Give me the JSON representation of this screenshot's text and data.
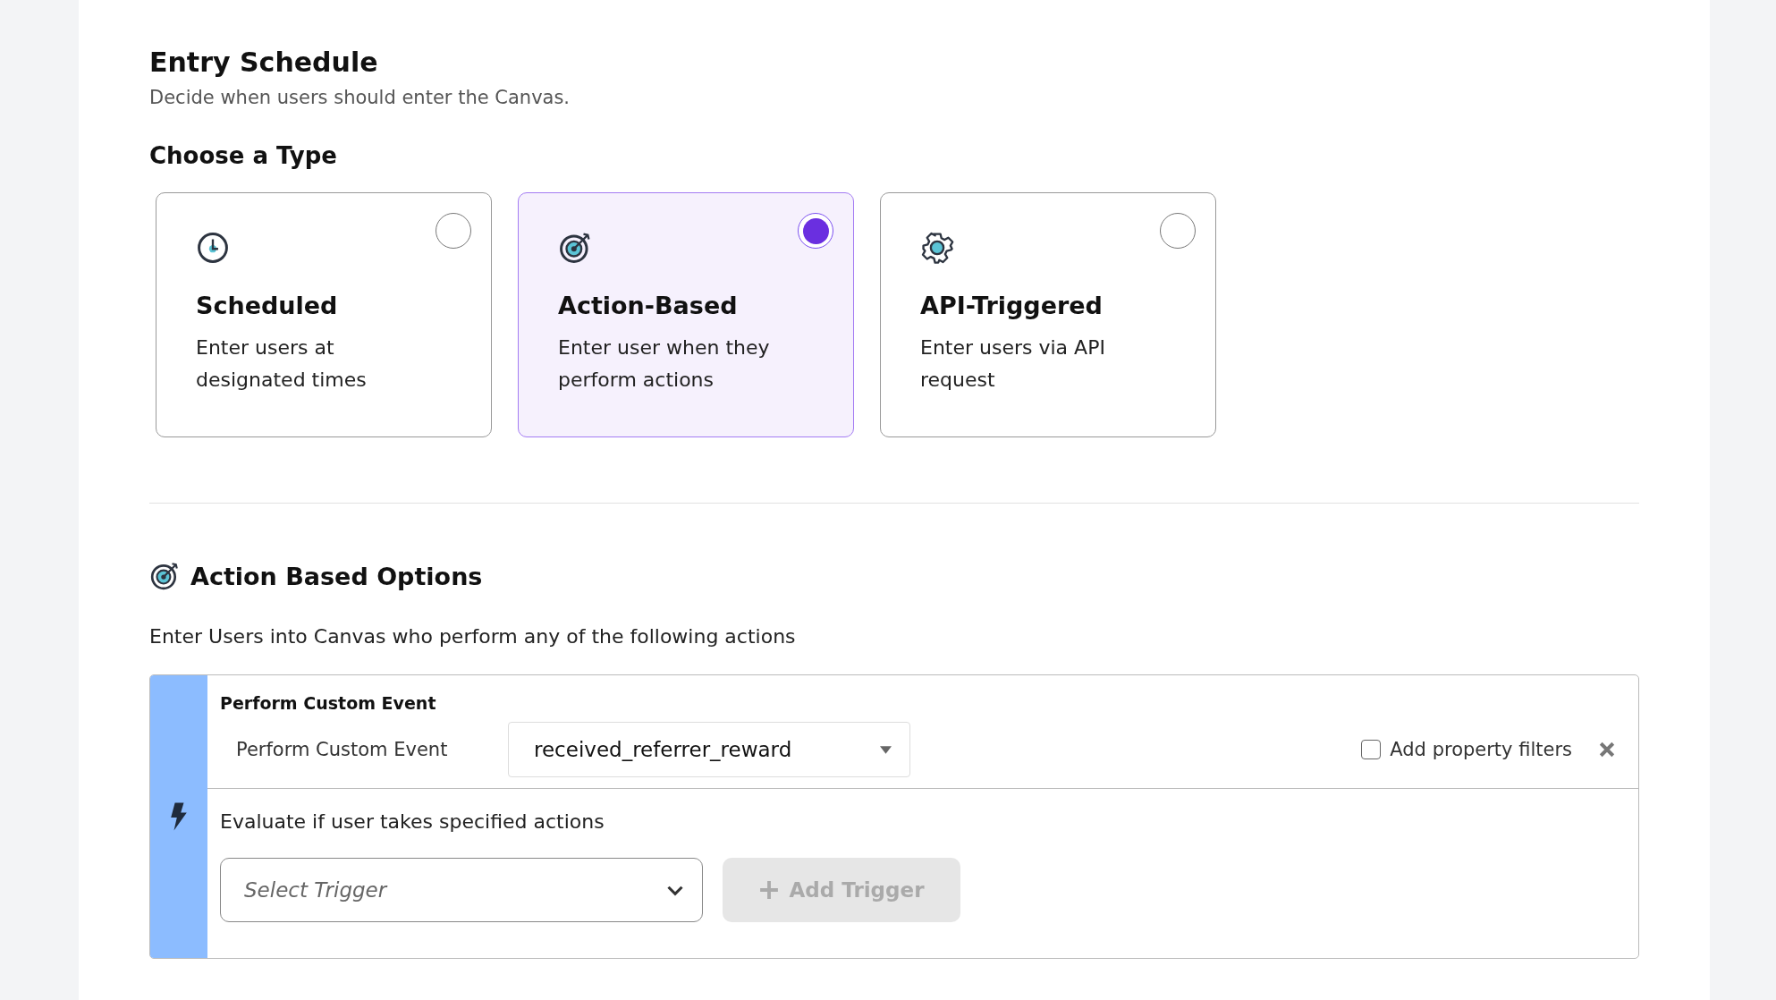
{
  "header": {
    "title": "Entry Schedule",
    "subtitle": "Decide when users should enter the Canvas."
  },
  "type_section": {
    "title": "Choose a Type"
  },
  "types": [
    {
      "kind": "clock",
      "title": "Scheduled",
      "description": "Enter users at designated times",
      "selected": false
    },
    {
      "kind": "target",
      "title": "Action-Based",
      "description": "Enter user when they perform actions",
      "selected": true
    },
    {
      "kind": "gear",
      "title": "API-Triggered",
      "description": "Enter users via API request",
      "selected": false
    }
  ],
  "options": {
    "title": "Action Based Options",
    "description": "Enter Users into Canvas who perform any of the following actions",
    "event": {
      "heading": "Perform Custom Event",
      "label": "Perform Custom Event",
      "value": "received_referrer_reward",
      "property_filters": {
        "label": "Add property filters",
        "checked": false
      }
    },
    "evaluate": {
      "label": "Evaluate if user takes specified actions",
      "trigger_placeholder": "Select Trigger",
      "add_button": {
        "label": "Add Trigger",
        "disabled": true
      }
    }
  }
}
